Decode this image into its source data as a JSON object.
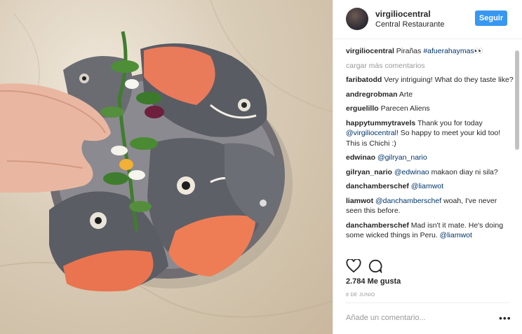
{
  "header": {
    "username": "virgiliocentral",
    "location": "Central Restaurante",
    "follow_label": "Seguir"
  },
  "caption": {
    "username": "virgiliocentral",
    "text": "Pirañas",
    "hashtag": "#afuerahaymas",
    "emoji": "👀"
  },
  "load_more": "cargar más comentarios",
  "comments": [
    {
      "user": "faribatodd",
      "text": "Very intriguing! What do they taste like?"
    },
    {
      "user": "andregrobman",
      "text": "Arte"
    },
    {
      "user": "erguelillo",
      "text": "Parecen Aliens"
    },
    {
      "user": "happytummytravels",
      "pre": "Thank you for today ",
      "mention": "@virgiliocentral",
      "post": "! So happy to meet your kid too! This is Chichi :)"
    },
    {
      "user": "edwinao",
      "mention": "@gilryan_nario"
    },
    {
      "user": "gilryan_nario",
      "mention": "@edwinao",
      "post": " makaon diay ni sila?"
    },
    {
      "user": "danchamberschef",
      "mention": "@liamwot"
    },
    {
      "user": "liamwot",
      "mention": "@danchamberschef",
      "post": " woah, I've never seen this before."
    },
    {
      "user": "danchamberschef",
      "text": "Mad isn't it mate. He's doing some wicked things in Peru.",
      "mention2": "@liamwot"
    }
  ],
  "likes": "2.784 Me gusta",
  "date": "8 DE JUNIO",
  "add_comment_placeholder": "Añade un comentario...",
  "more_options": "•••",
  "icons": {
    "like": "heart-icon",
    "comment": "comment-icon",
    "more": "more-options-icon"
  },
  "colors": {
    "follow": "#3897f0",
    "link": "#003569",
    "muted": "#999999"
  }
}
